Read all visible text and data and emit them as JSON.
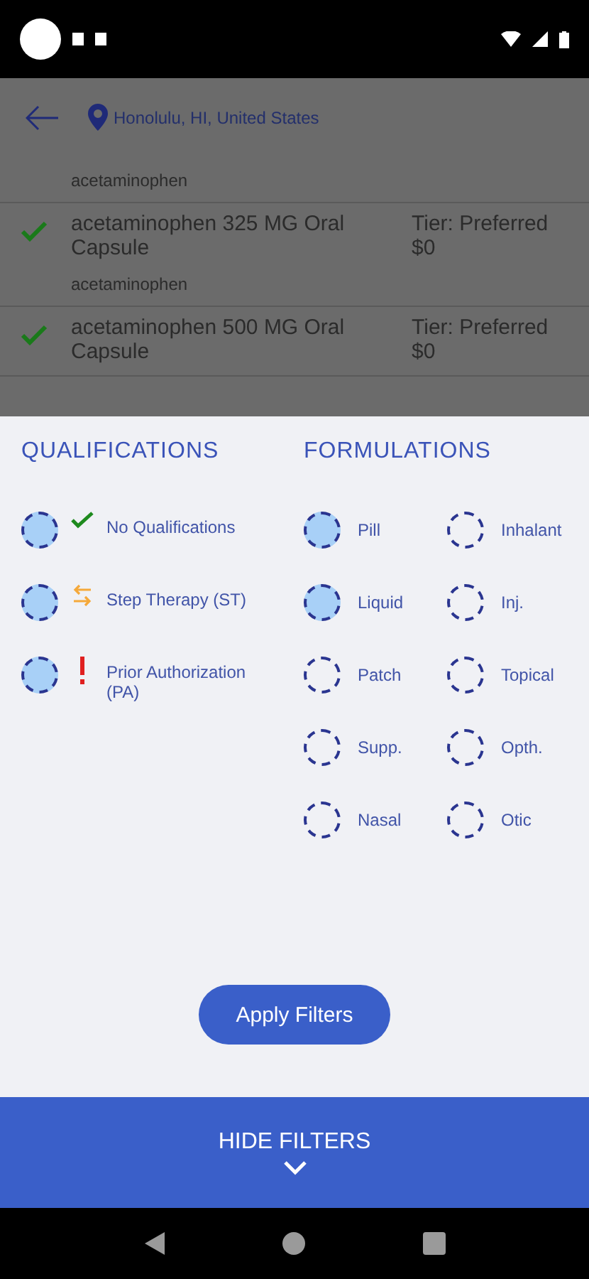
{
  "header": {
    "location": "Honolulu, HI, United States"
  },
  "results": [
    {
      "generic": "acetaminophen"
    },
    {
      "name": "acetaminophen 325 MG Oral Capsule",
      "tier": "Tier: Preferred",
      "price": "$0",
      "generic": "acetaminophen",
      "covered": true
    },
    {
      "name": "acetaminophen 500 MG Oral Capsule",
      "tier": "Tier: Preferred",
      "price": "$0",
      "covered": true
    }
  ],
  "filters": {
    "qualifications": {
      "title": "QUALIFICATIONS",
      "options": [
        {
          "label": "No Qualifications",
          "kind": "check",
          "checked": true
        },
        {
          "label": "Step Therapy (ST)",
          "kind": "swap",
          "checked": true
        },
        {
          "label": "Prior Authorization (PA)",
          "kind": "alert",
          "checked": true
        }
      ]
    },
    "formulations": {
      "title": "FORMULATIONS",
      "options": [
        {
          "label": "Pill",
          "checked": true
        },
        {
          "label": "Inhalant",
          "checked": false
        },
        {
          "label": "Liquid",
          "checked": true
        },
        {
          "label": "Inj.",
          "checked": false
        },
        {
          "label": "Patch",
          "checked": false
        },
        {
          "label": "Topical",
          "checked": false
        },
        {
          "label": "Supp.",
          "checked": false
        },
        {
          "label": "Opth.",
          "checked": false
        },
        {
          "label": "Nasal",
          "checked": false
        },
        {
          "label": "Otic",
          "checked": false
        }
      ]
    },
    "apply_button": "Apply Filters",
    "hide_button": "HIDE FILTERS"
  }
}
